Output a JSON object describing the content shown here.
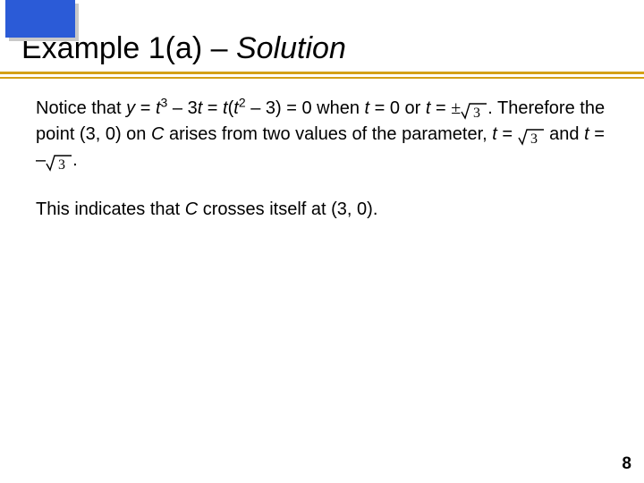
{
  "title": {
    "prefix": "Example 1(a) – ",
    "italic": "Solution"
  },
  "body": {
    "p1": {
      "t1": "Notice that ",
      "yvar": "y",
      "eq1": " = ",
      "tvar": "t",
      "sup3": "3",
      "minus3t": " – 3",
      "tvar2": "t",
      "eq2": " = ",
      "tvar3": "t",
      "lpar": "(",
      "tvar4": "t",
      "sup2": "2",
      "minus3": " – 3) = 0 when ",
      "tvar5": "t",
      "eq0": " = 0 or ",
      "tvar6": "t",
      "eqpm": " = ",
      "pm": "±",
      "period1": ".",
      "t2a": "Therefore the point (3, 0) on ",
      "Cvar": "C",
      "t2b": " arises from two values of the parameter, ",
      "tvar7": "t",
      "eq3": " = ",
      "and": " and ",
      "tvar8": "t",
      "eq4": " = ",
      "neg": "–",
      "period2": "."
    },
    "p2": {
      "t1": "This indicates that ",
      "Cvar": "C",
      "t2": " crosses itself at (3, 0)."
    },
    "sqrt_radicand": "3"
  },
  "pageNumber": "8"
}
